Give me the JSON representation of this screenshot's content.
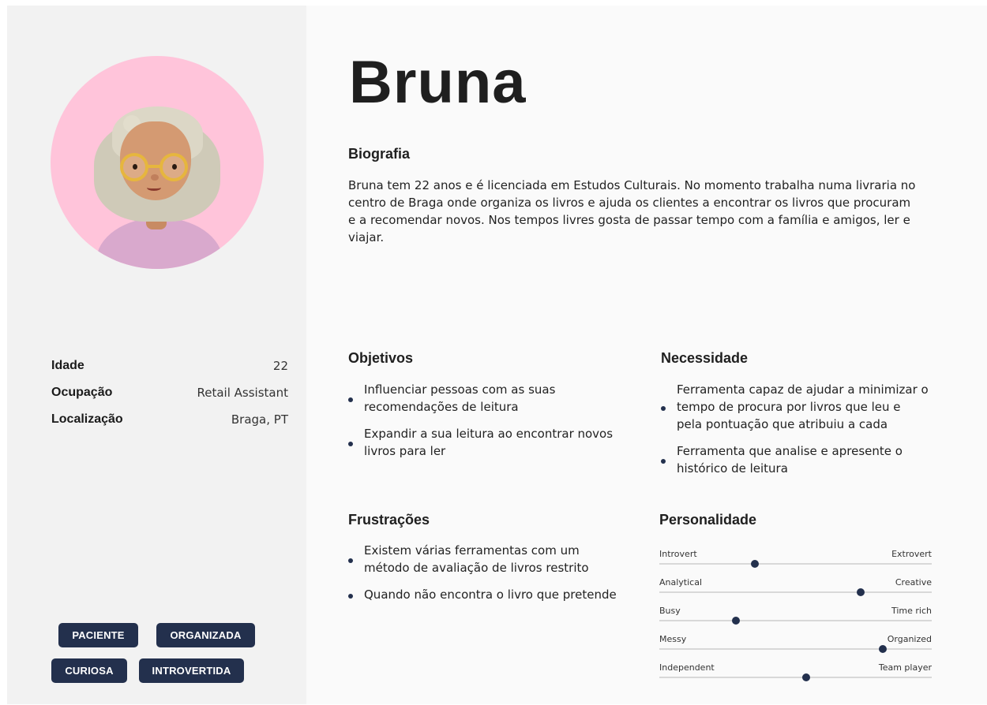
{
  "persona": {
    "name": "Bruna",
    "avatar_icon": "3d-avatar-woman-glasses"
  },
  "stats": [
    {
      "label": "Idade",
      "value": "22"
    },
    {
      "label": "Ocupação",
      "value": "Retail Assistant"
    },
    {
      "label": "Localização",
      "value": "Braga, PT"
    }
  ],
  "tags": [
    "PACIENTE",
    "ORGANIZADA",
    "CURIOSA",
    "INTROVERTIDA"
  ],
  "biography": {
    "title": "Biografia",
    "text": "Bruna tem 22 anos e é licenciada em Estudos Culturais. No momento trabalha numa livraria no centro de Braga onde organiza os livros e ajuda os clientes a encontrar os livros que procuram e a recomendar novos. Nos tempos livres gosta de passar tempo com a família e amigos, ler e viajar."
  },
  "goals": {
    "title": "Objetivos",
    "items": [
      "Influenciar pessoas com as suas recomendações de leitura",
      "Expandir a sua leitura ao encontrar novos livros para ler"
    ]
  },
  "needs": {
    "title": "Necessidade",
    "items": [
      "Ferramenta capaz de ajudar a minimizar o tempo de procura por livros que leu e pela pontuação que atribuiu a cada",
      "Ferramenta que analise e apresente o histórico de leitura"
    ]
  },
  "frustrations": {
    "title": "Frustrações",
    "items": [
      "Existem várias ferramentas com um método de avaliação de livros restrito",
      "Quando não encontra o livro que pretende"
    ]
  },
  "personality": {
    "title": "Personalidade",
    "traits": [
      {
        "left": "Introvert",
        "right": "Extrovert",
        "value": 0.35
      },
      {
        "left": "Analytical",
        "right": "Creative",
        "value": 0.74
      },
      {
        "left": "Busy",
        "right": "Time rich",
        "value": 0.28
      },
      {
        "left": "Messy",
        "right": "Organized",
        "value": 0.82
      },
      {
        "left": "Independent",
        "right": "Team player",
        "value": 0.54
      }
    ]
  },
  "colors": {
    "accent": "#23304d",
    "avatar_bg": "#ffc4da",
    "sidebar_bg": "#f2f2f2",
    "main_bg": "#fafafa"
  }
}
